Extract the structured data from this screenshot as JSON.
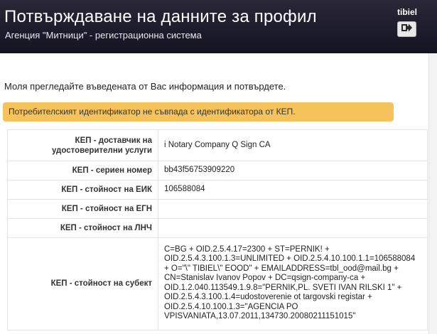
{
  "header": {
    "title": "Потвърждаване на данните за профил",
    "subtitle": "Агенция \"Митници\" - регистрационна система",
    "username": "tibiel",
    "logout_icon": "logout-arrow-icon"
  },
  "intro_text": "Моля прегледайте въведената от Вас информация и потвърдете.",
  "alert": {
    "text": "Потребителският идентификатор не съвпада с идентификатора от КЕП.",
    "color": "#f6c35a"
  },
  "details": {
    "rows": [
      {
        "label": "КЕП - доставчик на удостоверителни услуги",
        "value": "i Notary Company Q Sign CA"
      },
      {
        "label": "КЕП - сериен номер",
        "value": "bb43f56753909220"
      },
      {
        "label": "КЕП - стойност на ЕИК",
        "value": "106588084"
      },
      {
        "label": "КЕП - стойност на ЕГН",
        "value": ""
      },
      {
        "label": "КЕП - стойност на ЛНЧ",
        "value": ""
      },
      {
        "label": "КЕП - стойност на субект",
        "value": "C=BG + OID.2.5.4.17=2300 + ST=PERNIK! + OID.2.5.4.3.100.1.3=UNLIMITED + OID.2.5.4.10.100.1.1=106588084 + O=\"\\\" TIBIEL\\\" EOOD\" + EMAILADDRESS=tbl_ood@mail.bg + CN=Stanislav Ivanov Popov + DC=qsign-company-ca + OID.1.2.040.113549.1.9.8=\"PERNIK,PL. SVETI IVAN RILSKI 1\" + OID.2.5.4.3.100.1.4=udostoverenie ot targovski registar + OID.2.5.4.10.100.1.3=\"AGENCIA PO VPISVANIATA,13.07.2011,134730.20080211151015\""
      }
    ]
  }
}
